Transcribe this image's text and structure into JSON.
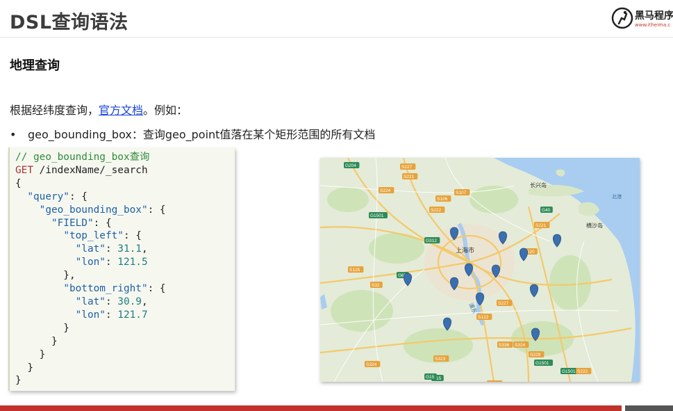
{
  "header": {
    "title": "DSL查询语法",
    "logo_name": "黑马程序",
    "logo_url": "www.itheima.c"
  },
  "section": {
    "title": "地理查询"
  },
  "intro": {
    "prefix": "根据经纬度查询，",
    "link": "官方文档",
    "suffix": "。例如："
  },
  "bullet": {
    "marker": "•",
    "text": "geo_bounding_box：查询geo_point值落在某个矩形范围的所有文档"
  },
  "code": {
    "comment": "// geo_bounding_box查询",
    "method": "GET",
    "path": " /indexName/_search",
    "open_brace": "{",
    "query_key": "\"query\"",
    "gbb_key": "\"geo_bounding_box\"",
    "field_key": "\"FIELD\"",
    "top_left_key": "\"top_left\"",
    "bottom_right_key": "\"bottom_right\"",
    "lat_key": "\"lat\"",
    "lon_key": "\"lon\"",
    "top_left_lat": "31.1",
    "top_left_lon": "121.5",
    "bottom_right_lat": "30.9",
    "bottom_right_lon": "121.7",
    "close_brace": "}"
  },
  "map": {
    "city_label": "上海市",
    "island_label": "长兴岛",
    "island2_label": "横沙岛",
    "sea_label": "北港",
    "district_label": "浦东",
    "marker_color": "#3a6fb0",
    "water_color": "#a8cdf0",
    "road_labels": [
      "G204",
      "S227",
      "S221",
      "S224",
      "S106",
      "S107",
      "G1501",
      "S222",
      "G312",
      "S125",
      "G60",
      "S32",
      "S227",
      "S122",
      "G1501",
      "S324",
      "S323",
      "G15",
      "S336",
      "S324",
      "S229",
      "G1501",
      "S222",
      "G15",
      "S123",
      "G40",
      "S221",
      "S20"
    ]
  },
  "colors": {
    "accent_red": "#c0322b",
    "link_blue": "#1a45d8"
  }
}
